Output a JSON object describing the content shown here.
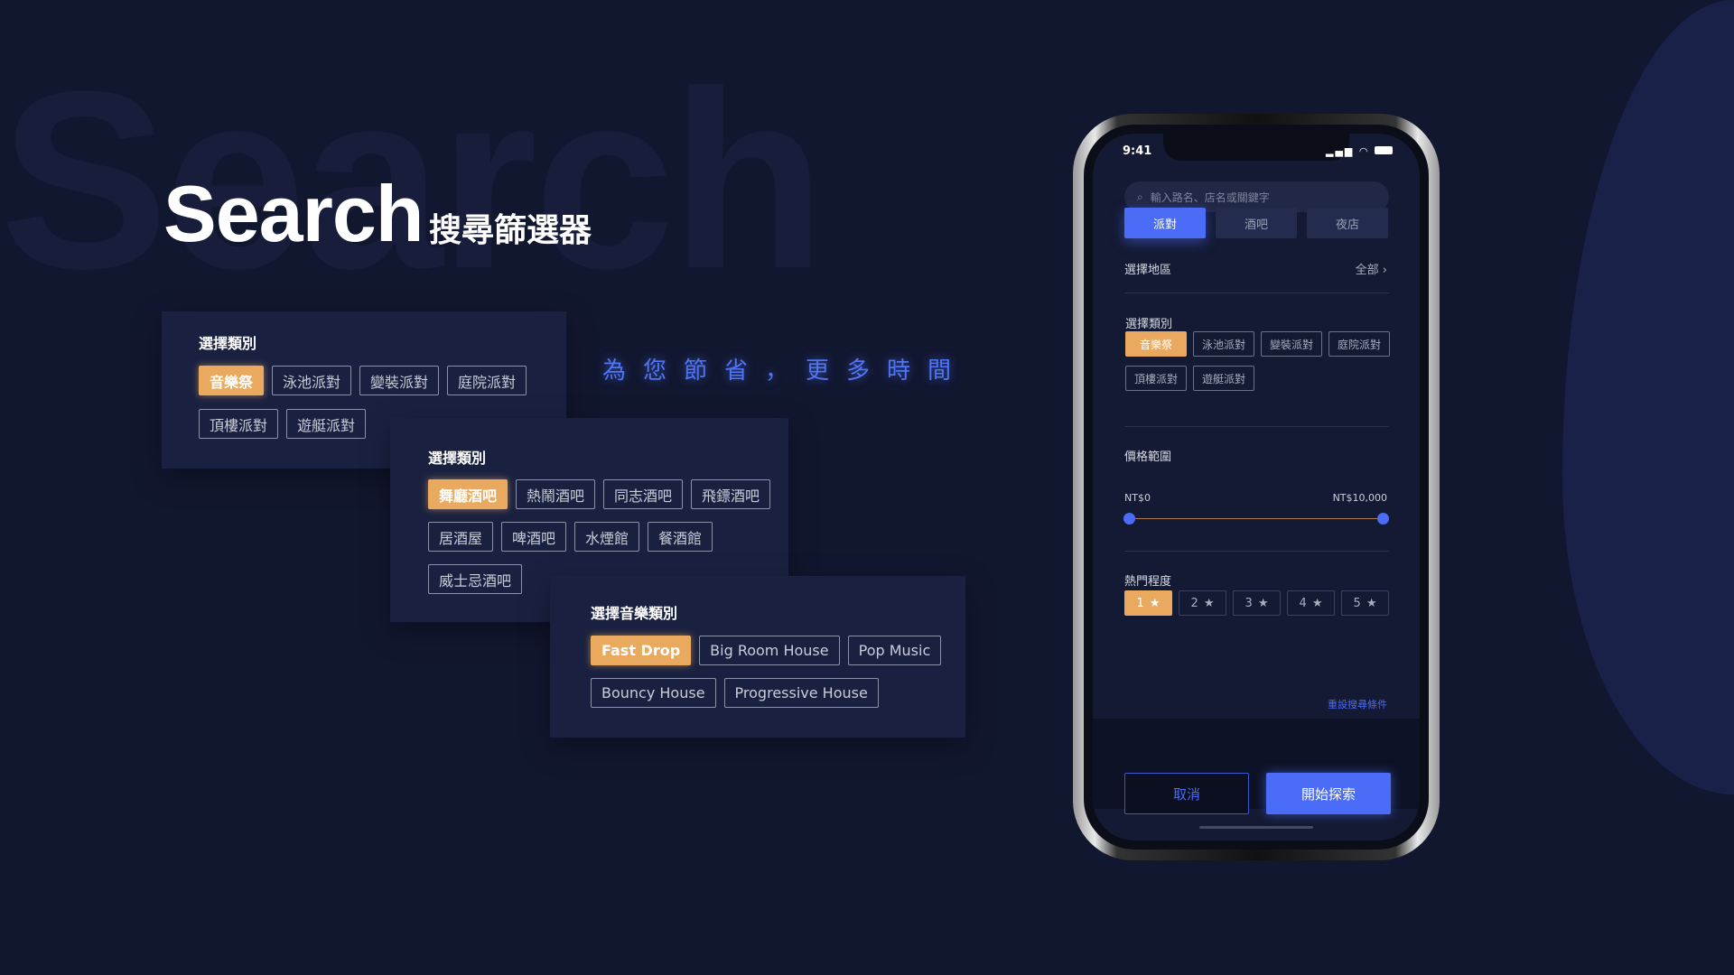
{
  "hero": {
    "watermark": "Search",
    "title": "Search",
    "subtitle": "搜尋篩選器",
    "tagline": "為您節省，更多時間"
  },
  "colors": {
    "background": "#121730",
    "card": "#1a2140",
    "accent_orange": "#e9a95e",
    "accent_blue": "#4a6cf7"
  },
  "card1": {
    "title": "選擇類別",
    "chips": [
      {
        "label": "音樂祭",
        "selected": true
      },
      {
        "label": "泳池派對"
      },
      {
        "label": "變裝派對"
      },
      {
        "label": "庭院派對"
      },
      {
        "label": "頂樓派對"
      },
      {
        "label": "遊艇派對"
      }
    ]
  },
  "card2": {
    "title": "選擇類別",
    "chips": [
      {
        "label": "舞廳酒吧",
        "selected": true
      },
      {
        "label": "熱鬧酒吧"
      },
      {
        "label": "同志酒吧"
      },
      {
        "label": "飛鏢酒吧"
      },
      {
        "label": "居酒屋"
      },
      {
        "label": "啤酒吧"
      },
      {
        "label": "水煙館"
      },
      {
        "label": "餐酒館"
      },
      {
        "label": "威士忌酒吧"
      }
    ]
  },
  "card3": {
    "title": "選擇音樂類別",
    "chips": [
      {
        "label": "Fast Drop",
        "selected": true
      },
      {
        "label": "Big Room House"
      },
      {
        "label": "Pop Music"
      },
      {
        "label": "Bouncy House"
      },
      {
        "label": "Progressive House"
      }
    ]
  },
  "phone": {
    "time": "9:41",
    "search_placeholder": "輸入路名、店名或關鍵字",
    "tabs": [
      {
        "label": "派對",
        "selected": true
      },
      {
        "label": "酒吧"
      },
      {
        "label": "夜店"
      }
    ],
    "region": {
      "label": "選擇地區",
      "value": "全部"
    },
    "category": {
      "label": "選擇類別",
      "chips": [
        {
          "label": "音樂祭",
          "selected": true
        },
        {
          "label": "泳池派對"
        },
        {
          "label": "變裝派對"
        },
        {
          "label": "庭院派對"
        },
        {
          "label": "頂樓派對"
        },
        {
          "label": "遊艇派對"
        }
      ]
    },
    "price": {
      "label": "價格範圍",
      "min_label": "NT$0",
      "max_label": "NT$10,000",
      "min_value": 0,
      "max_value": 10000
    },
    "popularity": {
      "label": "熱門程度",
      "levels": [
        "1",
        "2",
        "3",
        "4",
        "5"
      ],
      "selected": "1"
    },
    "reset": "重設搜尋條件",
    "cancel": "取消",
    "start": "開始探索"
  }
}
